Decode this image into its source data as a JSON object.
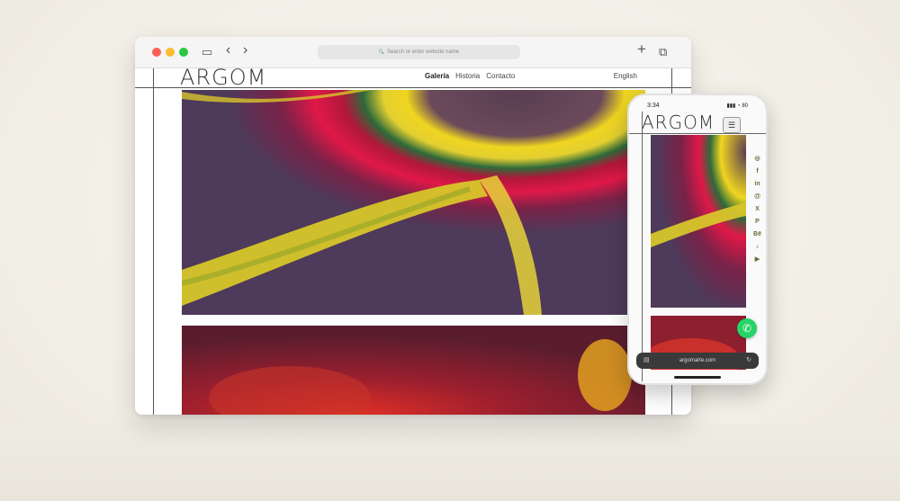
{
  "browser": {
    "address_placeholder": "Search or enter website name",
    "search_glyph": "🔍",
    "back_glyph": "‹",
    "forward_glyph": "›",
    "new_tab_glyph": "+",
    "tabs_glyph": "⧉",
    "sidebar_glyph": "▭"
  },
  "site": {
    "logo": "ARGOM",
    "nav": [
      "Galería",
      "Historia",
      "Contacto"
    ],
    "language": "English"
  },
  "phone": {
    "time": "3:34",
    "status_icons": "▮▮▮ ◔ 80",
    "logo": "ARGOM",
    "menu_glyph": "☰",
    "url": "argomarte.com",
    "url_left_glyph": "▤",
    "url_right_glyph": "↻",
    "whatsapp_glyph": "✆",
    "socials": [
      {
        "name": "instagram-icon",
        "glyph": "◎"
      },
      {
        "name": "facebook-icon",
        "glyph": "f"
      },
      {
        "name": "linkedin-icon",
        "glyph": "in"
      },
      {
        "name": "threads-icon",
        "glyph": "@"
      },
      {
        "name": "x-icon",
        "glyph": "X"
      },
      {
        "name": "pinterest-icon",
        "glyph": "P"
      },
      {
        "name": "behance-icon",
        "glyph": "Bē"
      },
      {
        "name": "tiktok-icon",
        "glyph": "♪"
      },
      {
        "name": "youtube-icon",
        "glyph": "▶"
      }
    ]
  },
  "colors": {
    "accent_social": "#6b6b3a",
    "whatsapp": "#25d366"
  }
}
